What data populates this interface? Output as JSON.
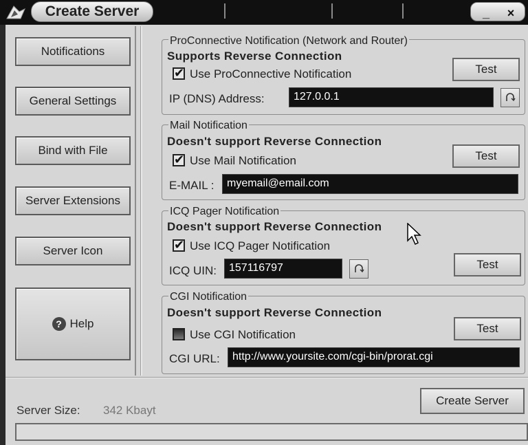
{
  "window": {
    "title": "Create Server",
    "minimize_label": "_",
    "close_label": "×"
  },
  "sidebar": {
    "items": [
      {
        "label": "Notifications"
      },
      {
        "label": "General Settings"
      },
      {
        "label": "Bind with File"
      },
      {
        "label": "Server Extensions"
      },
      {
        "label": "Server Icon"
      }
    ],
    "help_label": "Help",
    "help_icon": "?"
  },
  "proconnective": {
    "legend": "ProConnective Notification (Network and Router)",
    "support": "Supports Reverse Connection",
    "checkbox_label": "Use ProConnective Notification",
    "checked": true,
    "test_label": "Test",
    "field_label": "IP (DNS) Address:",
    "field_value": "127.0.0.1"
  },
  "mail": {
    "legend": "Mail Notification",
    "support": "Doesn't support Reverse Connection",
    "checkbox_label": "Use Mail Notification",
    "checked": true,
    "test_label": "Test",
    "field_label": "E-MAIL :",
    "field_value": "myemail@email.com"
  },
  "icq": {
    "legend": "ICQ Pager Notification",
    "support": "Doesn't support Reverse Connection",
    "checkbox_label": "Use ICQ Pager Notification",
    "checked": true,
    "test_label": "Test",
    "field_label": "ICQ UIN:",
    "field_value": "157116797"
  },
  "cgi": {
    "legend": "CGI Notification",
    "support": "Doesn't support Reverse Connection",
    "checkbox_label": "Use CGI Notification",
    "checked": false,
    "test_label": "Test",
    "field_label": "CGI URL:",
    "field_value": "http://www.yoursite.com/cgi-bin/prorat.cgi"
  },
  "footer": {
    "size_label": "Server Size:",
    "size_value": "342 Kbayt",
    "create_label": "Create Server"
  }
}
